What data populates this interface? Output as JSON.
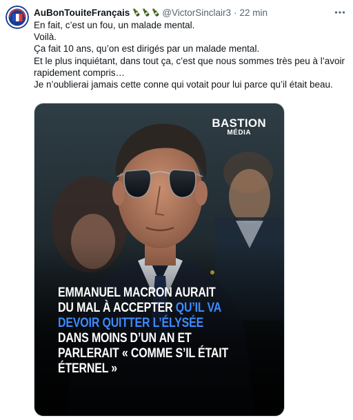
{
  "tweet": {
    "display_name": "AuBonTouiteFrançais",
    "handle": "@VictorSinclair3",
    "separator": "·",
    "time": "22 min",
    "more_icon": "more-horizontal-icon",
    "avatar_badge_text": [
      "MADE IN",
      "FRANCE"
    ],
    "name_emojis": [
      "champagne-bottle-icon",
      "champagne-bottle-icon",
      "champagne-bottle-icon"
    ],
    "lines": [
      "En fait, c’est un fou, un malade mental.",
      "Voilà.",
      "Ça fait 10 ans, qu’on est dirigés par un malade mental.",
      "Et le plus inquiétant, dans tout ça, c’est que nous sommes très peu à l’avoir rapidement compris…",
      "Je n’oublierai jamais cette conne qui votait pour lui parce qu’il était beau."
    ]
  },
  "media": {
    "logo_line1": "BASTION",
    "logo_line2": "MÉDIA",
    "headline_part1": "Emmanuel Macron aurait du mal à accepter ",
    "headline_highlight": "qu’il va devoir quitter l’Élysée",
    "headline_part2": " dans moins d’un an et parlerait « comme s’il était éternel »",
    "colors": {
      "highlight": "#3d8bff",
      "text": "#ffffff"
    }
  },
  "colors": {
    "primary_text": "#0f1419",
    "secondary_text": "#536471",
    "border": "#cfd9de"
  }
}
